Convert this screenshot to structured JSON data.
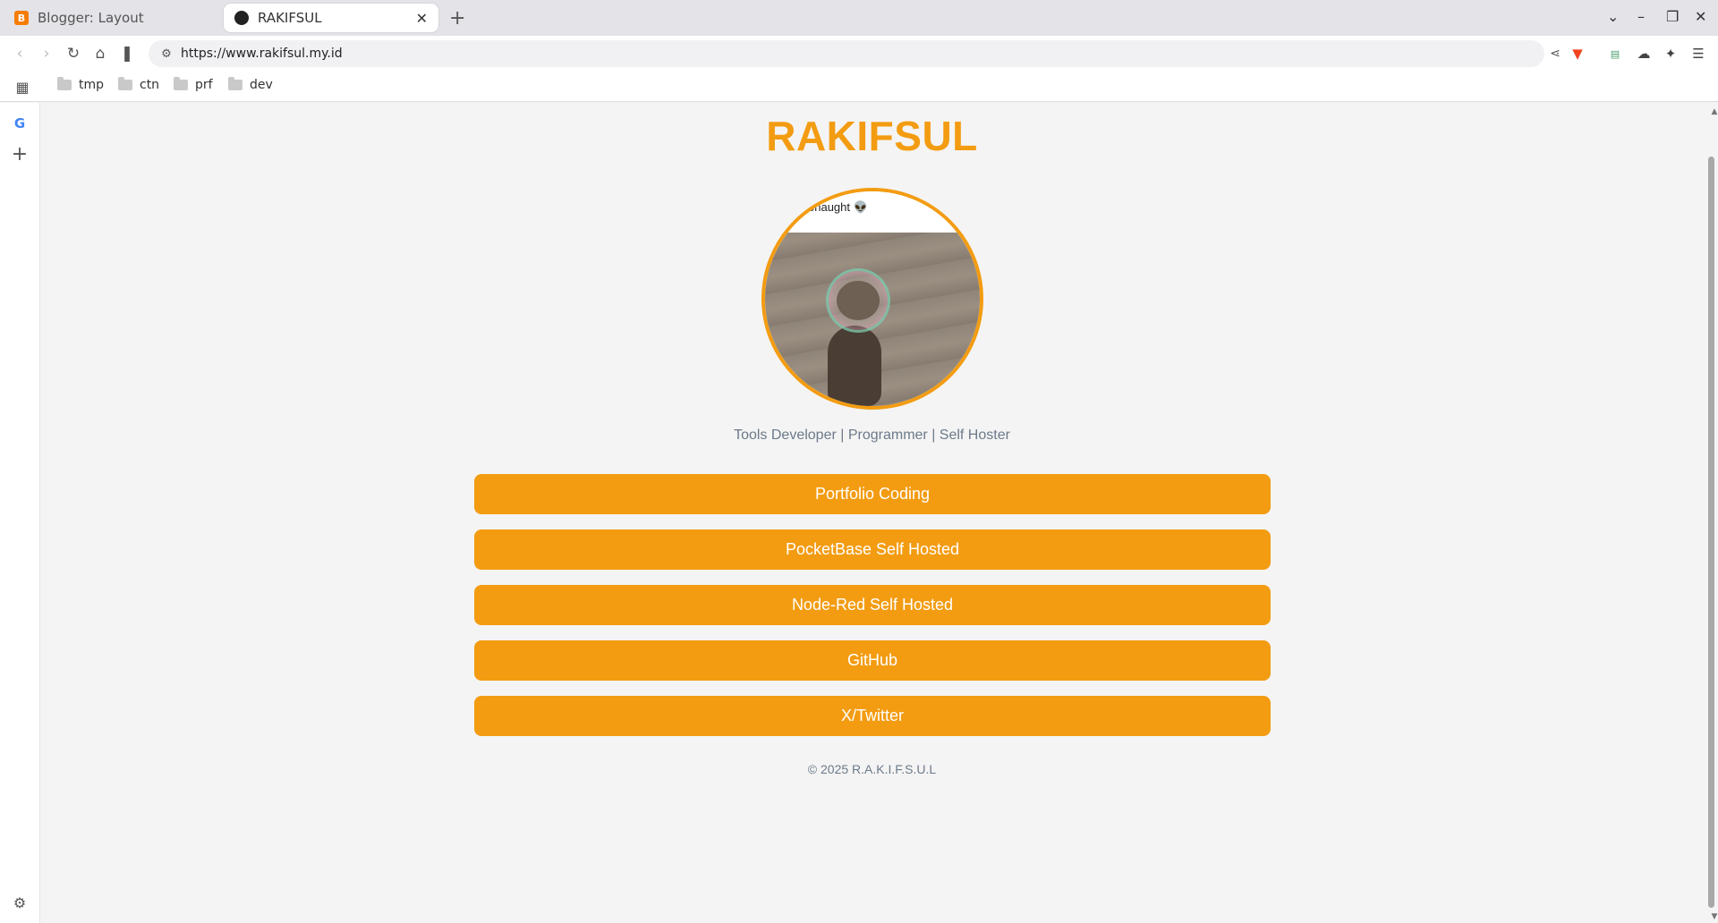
{
  "browser": {
    "tabs": [
      {
        "title": "Blogger: Layout",
        "active": false,
        "favicon": "blogger-icon"
      },
      {
        "title": "RAKIFSUL",
        "active": true,
        "favicon": "site-icon"
      }
    ],
    "url": "https://www.rakifsul.my.id",
    "bookmarks": [
      {
        "label": "tmp"
      },
      {
        "label": "ctn"
      },
      {
        "label": "prf"
      },
      {
        "label": "dev"
      }
    ],
    "accent_color": "#f39c12"
  },
  "page": {
    "title": "RAKIFSUL",
    "avatar_caption": "onaught 👽",
    "tagline": "Tools Developer | Programmer | Self Hoster",
    "links": [
      {
        "label": "Portfolio Coding"
      },
      {
        "label": "PocketBase Self Hosted"
      },
      {
        "label": "Node-Red Self Hosted"
      },
      {
        "label": "GitHub"
      },
      {
        "label": "X/Twitter"
      }
    ],
    "footer": "© 2025 R.A.K.I.F.S.U.L"
  }
}
